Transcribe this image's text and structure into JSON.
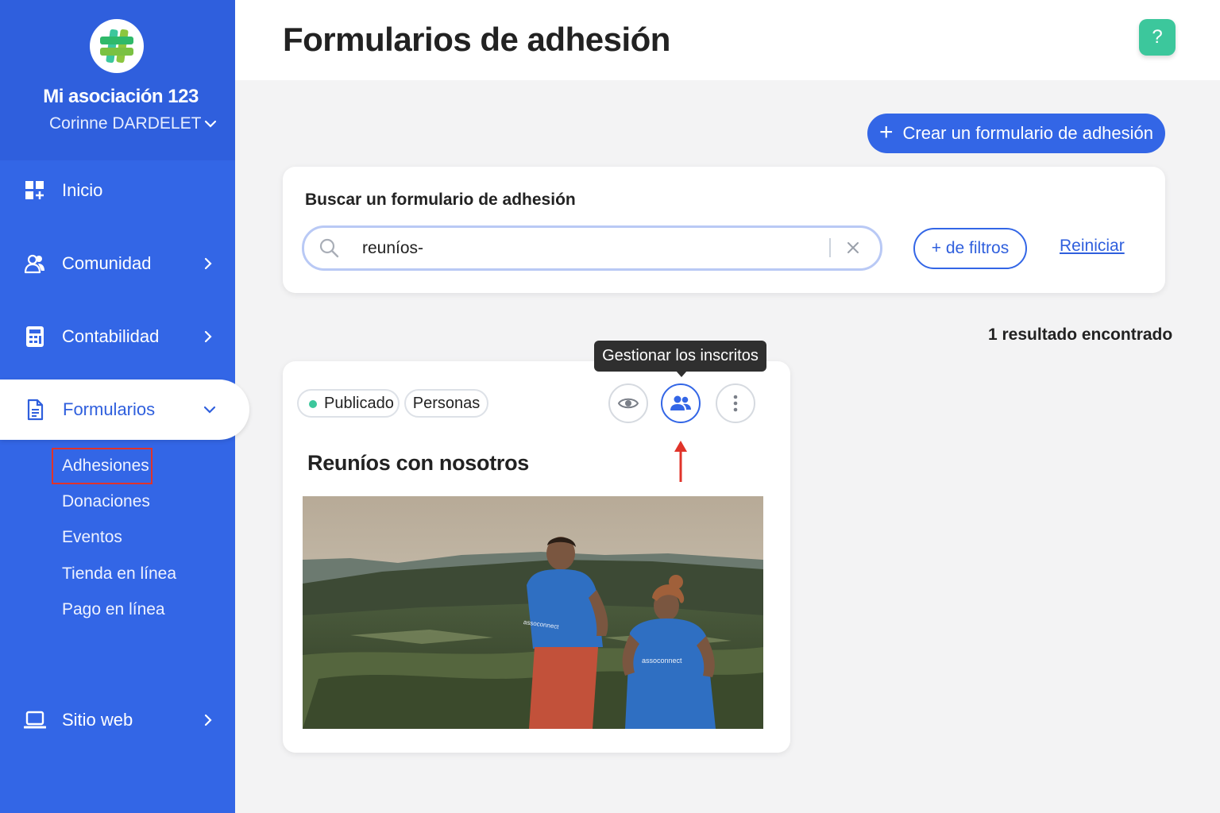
{
  "sidebar": {
    "org_name": "Mi asociación 123",
    "user_name": "Corinne DARDELET",
    "nav": [
      {
        "label": "Inicio",
        "icon": "dashboard-icon"
      },
      {
        "label": "Comunidad",
        "icon": "users-icon"
      },
      {
        "label": "Contabilidad",
        "icon": "calculator-icon"
      },
      {
        "label": "Formularios",
        "icon": "document-icon",
        "active": true
      },
      {
        "label": "Sitio web",
        "icon": "laptop-icon"
      }
    ],
    "sub_items": [
      "Adhesiones",
      "Donaciones",
      "Eventos",
      "Tienda en línea",
      "Pago en línea"
    ],
    "current_sub_item": "Adhesiones"
  },
  "header": {
    "title": "Formularios de adhesión",
    "help_label": "?"
  },
  "actions": {
    "create_label": "Crear un formulario de adhesión"
  },
  "search": {
    "title": "Buscar un formulario de adhesión",
    "value": "reuníos-",
    "filters_label": "+ de filtros",
    "reset_label": "Reiniciar"
  },
  "results": {
    "count_label": "1 resultado encontrado"
  },
  "form_card": {
    "status_label": "Publicado",
    "type_label": "Personas",
    "tooltip": "Gestionar los inscritos",
    "title": "Reuníos con nosotros",
    "image_shirt_text": "assoconnect"
  },
  "colors": {
    "primary": "#3366e6",
    "primary_dark": "#2f5fdd",
    "accent_green": "#3cc79c",
    "highlight_red": "#e0332a",
    "background": "#f3f3f4"
  }
}
